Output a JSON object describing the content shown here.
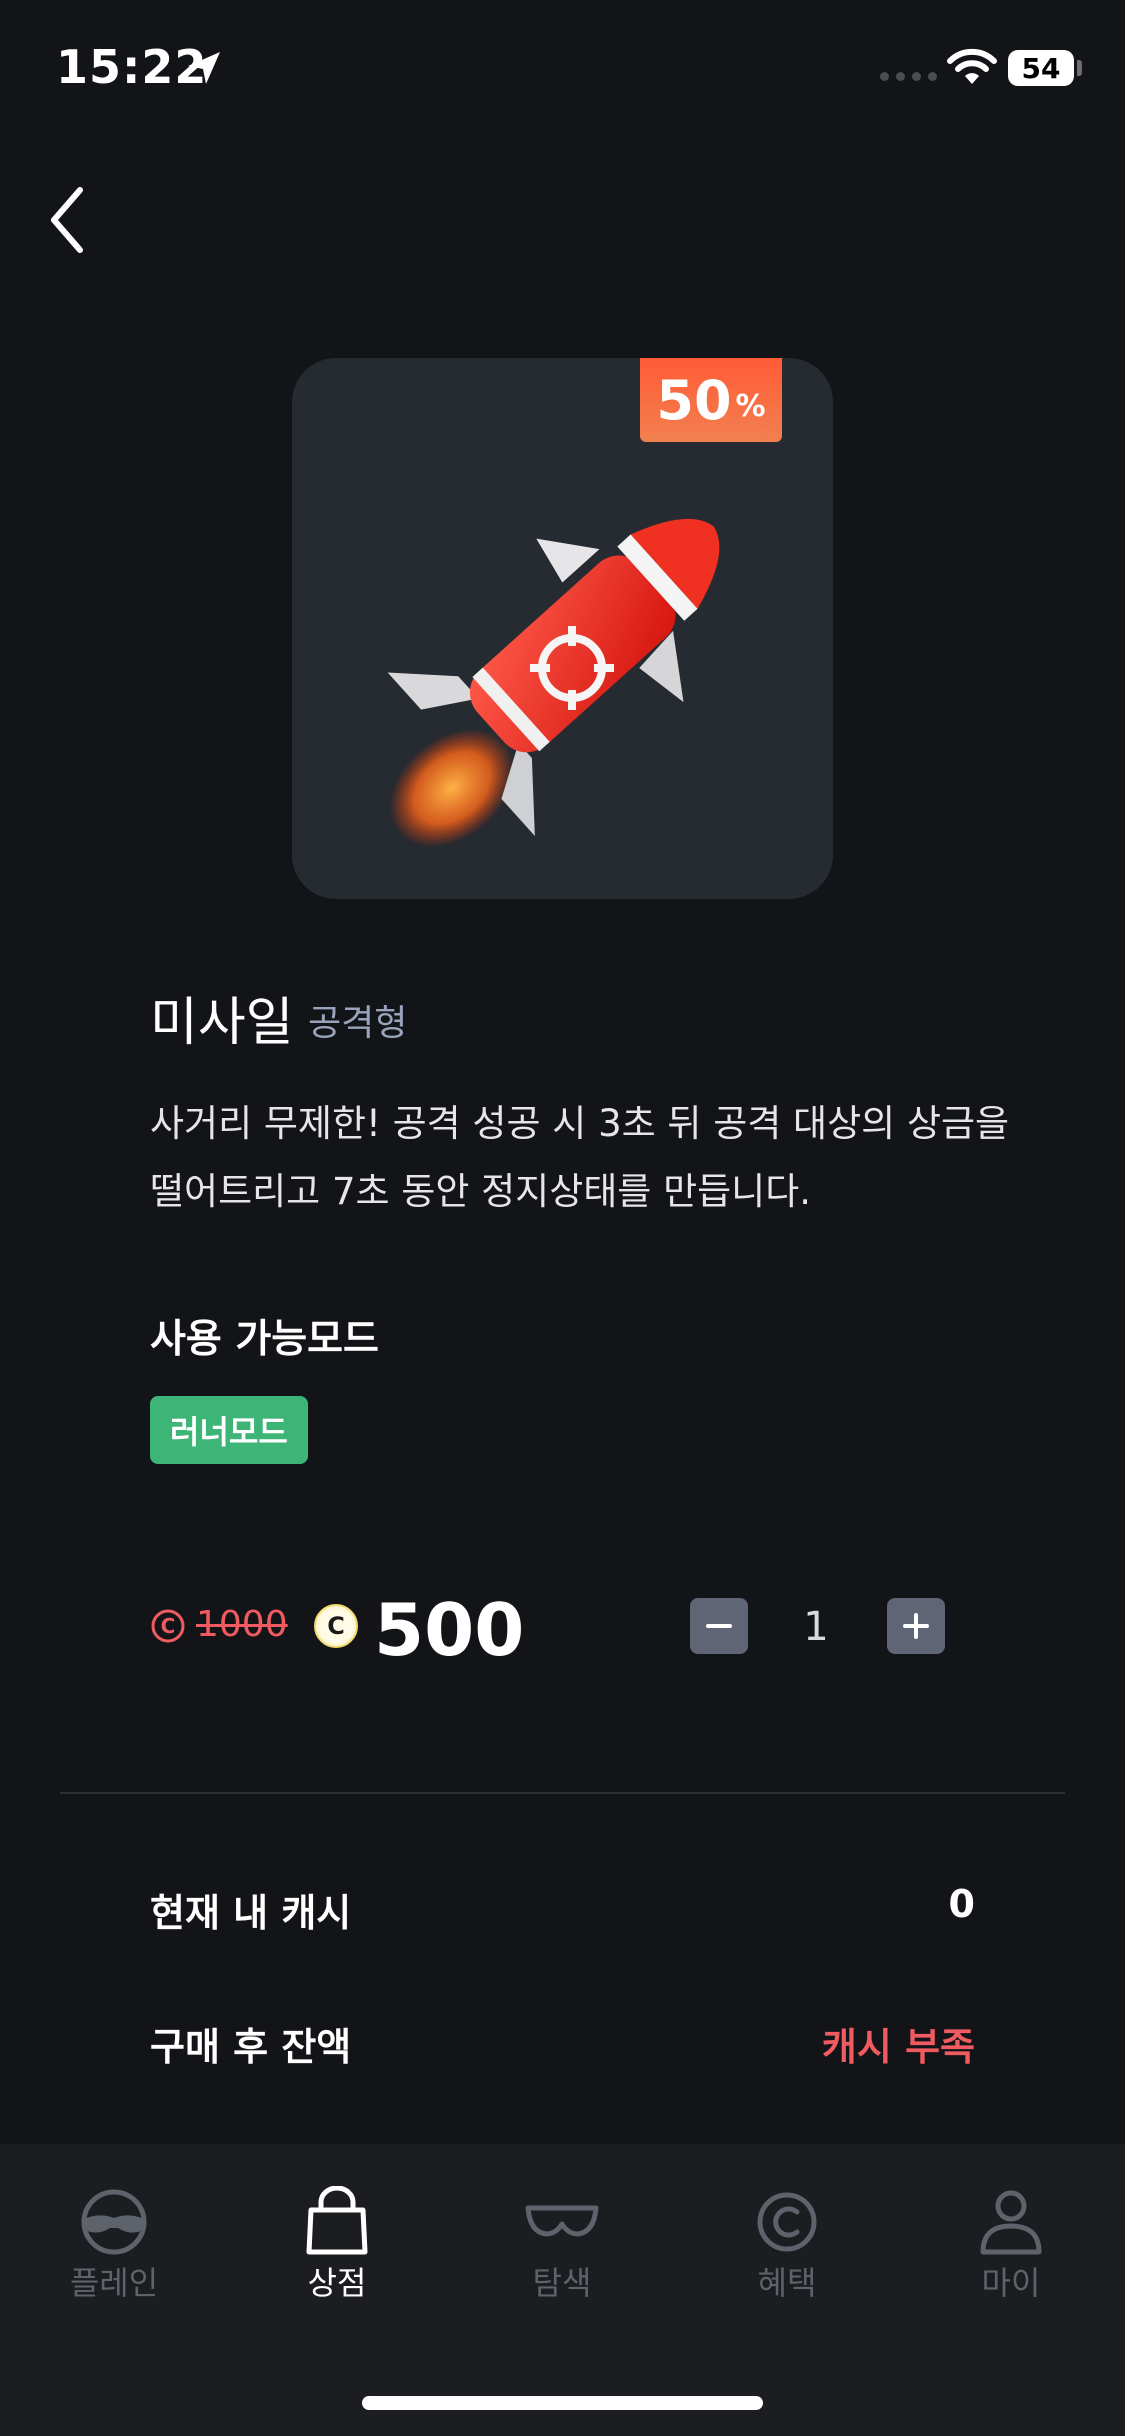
{
  "status_bar": {
    "time": "15:22",
    "battery": "54"
  },
  "product": {
    "discount_number": "50",
    "discount_unit": "%",
    "name": "미사일",
    "type": "공격형",
    "description": "사거리 무제한! 공격 성공 시 3초 뒤 공격 대상의 상금을 떨어트리고 7초 동안 정지상태를 만듭니다.",
    "available_modes_title": "사용 가능모드",
    "modes": [
      "러너모드"
    ]
  },
  "price": {
    "original": "1000",
    "current": "500",
    "quantity": "1",
    "coin_symbol": "C"
  },
  "summary": {
    "current_cash_label": "현재 내 캐시",
    "current_cash_value": "0",
    "balance_after_label": "구매 후 잔액",
    "balance_after_value": "캐시 부족"
  },
  "nav": {
    "items": [
      {
        "label": "플레인",
        "icon": "play-face-icon",
        "active": false
      },
      {
        "label": "상점",
        "icon": "shopping-bag-icon",
        "active": true
      },
      {
        "label": "탐색",
        "icon": "goggles-icon",
        "active": false
      },
      {
        "label": "혜택",
        "icon": "coin-icon",
        "active": false
      },
      {
        "label": "마이",
        "icon": "person-icon",
        "active": false
      }
    ]
  },
  "colors": {
    "background": "#131417",
    "card": "#262a31",
    "accent_red": "#ef5b61",
    "mode_tag_green": "#3db577",
    "badge_orange": "#f56a42"
  }
}
